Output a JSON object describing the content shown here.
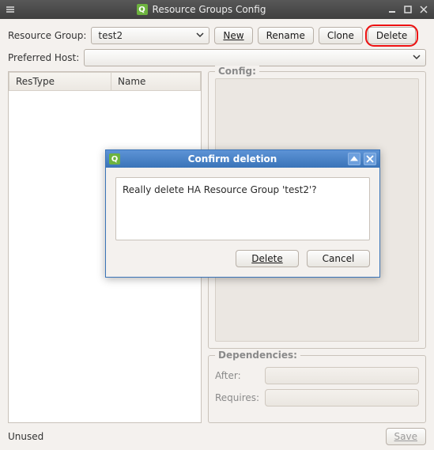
{
  "window": {
    "title": "Resource Groups Config"
  },
  "toolbar_row": {
    "label": "Resource Group:",
    "selected": "test2",
    "new_btn": "New",
    "rename_btn": "Rename",
    "clone_btn": "Clone",
    "delete_btn": "Delete"
  },
  "host_row": {
    "label": "Preferred Host:",
    "selected": ""
  },
  "left_panel": {
    "col1": "ResType",
    "col2": "Name"
  },
  "config_box": {
    "legend": "Config:"
  },
  "deps_box": {
    "legend": "Dependencies:",
    "after_label": "After:",
    "requires_label": "Requires:"
  },
  "footer": {
    "status": "Unused",
    "save_btn": "Save"
  },
  "dialog": {
    "title": "Confirm deletion",
    "message": "Really delete HA Resource Group 'test2'?",
    "delete_btn": "Delete",
    "cancel_btn": "Cancel"
  }
}
